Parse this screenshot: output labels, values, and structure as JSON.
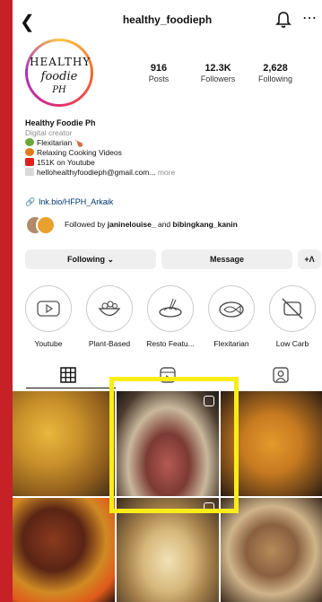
{
  "header": {
    "back_icon": "chevron-left-icon",
    "username": "healthy_foodieph",
    "bell_icon": "bell-icon",
    "more_icon": "more-horizontal-icon"
  },
  "profile": {
    "logo": {
      "line1": "HEALTHY",
      "line2": "foodie",
      "line3": "PH"
    },
    "stats": [
      {
        "value": "916",
        "label": "Posts"
      },
      {
        "value": "12.3K",
        "label": "Followers"
      },
      {
        "value": "2,628",
        "label": "Following"
      }
    ],
    "name": "Healthy Foodie Ph",
    "category": "Digital creator",
    "bio_lines": [
      {
        "icon": "green-salad-icon",
        "text": "Flexitarian 🍗"
      },
      {
        "icon": "orange-circle-icon",
        "text": "Relaxing Cooking Videos"
      },
      {
        "icon": "red-play-icon",
        "text": "151K on Youtube"
      },
      {
        "icon": "envelope-icon",
        "text": "hellohealthyfoodieph@gmail.com..."
      }
    ],
    "more_label": "more",
    "link": "lnk.bio/HFPH_Arkaik",
    "followed_by": {
      "prefix": "Followed by",
      "user1": "janinelouise_",
      "and": "and",
      "user2": "bibingkang_kanin"
    }
  },
  "buttons": {
    "following": "Following ⌄",
    "message": "Message",
    "add_person": "+Ʌ"
  },
  "highlights": [
    {
      "label": "Youtube",
      "icon": "youtube-icon"
    },
    {
      "label": "Plant-Based",
      "icon": "salad-bowl-icon"
    },
    {
      "label": "Resto Featu...",
      "icon": "pasta-plate-icon"
    },
    {
      "label": "Flexitarian",
      "icon": "fish-plate-icon"
    },
    {
      "label": "Low Carb",
      "icon": "no-bread-icon"
    }
  ],
  "tabs": [
    "grid-icon",
    "reels-icon",
    "tagged-icon"
  ],
  "colors": {
    "background": "#c62127",
    "link": "#00376b",
    "highlight_box": "#f8ee17"
  }
}
